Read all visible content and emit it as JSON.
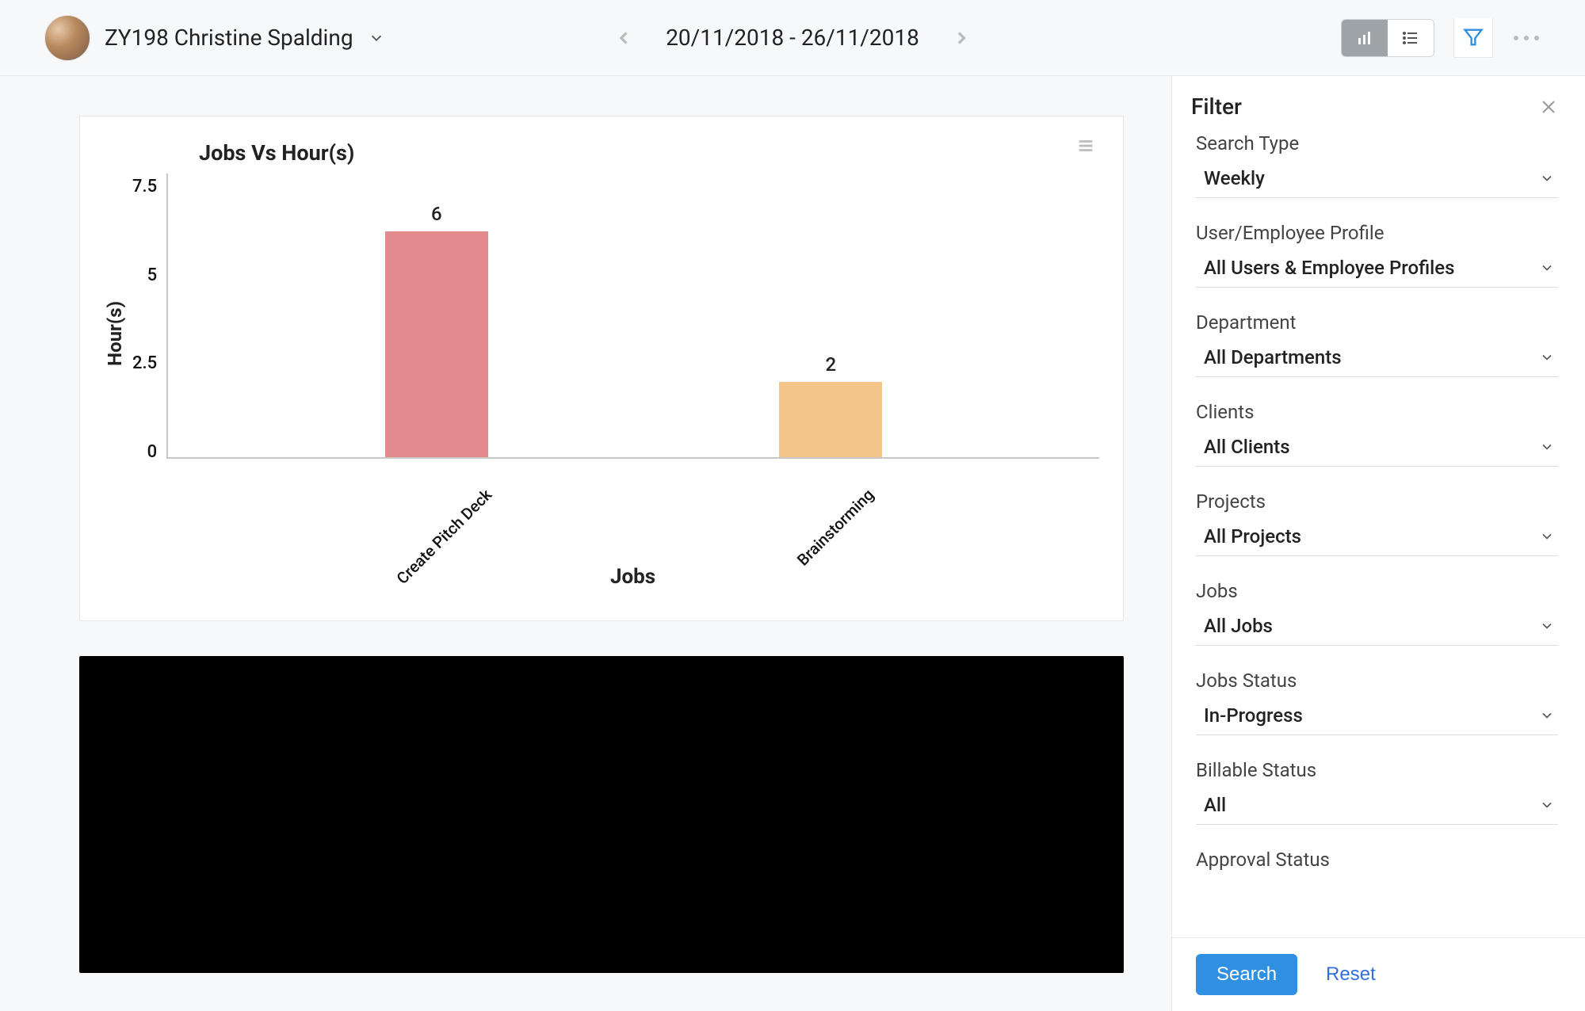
{
  "header": {
    "user_name": "ZY198 Christine Spalding",
    "date_range": "20/11/2018 - 26/11/2018"
  },
  "chart_data": {
    "type": "bar",
    "title": "Jobs Vs Hour(s)",
    "xlabel": "Jobs",
    "ylabel": "Hour(s)",
    "ylim": [
      0,
      7.5
    ],
    "y_ticks": [
      "7.5",
      "5",
      "2.5",
      "0"
    ],
    "categories": [
      "Create Pitch Deck",
      "Brainstorming"
    ],
    "values": [
      6,
      2
    ],
    "colors": [
      "#e48b8d",
      "#f3c58a"
    ]
  },
  "filter": {
    "title": "Filter",
    "groups": [
      {
        "label": "Search Type",
        "value": "Weekly"
      },
      {
        "label": "User/Employee Profile",
        "value": "All Users & Employee Profiles"
      },
      {
        "label": "Department",
        "value": "All Departments"
      },
      {
        "label": "Clients",
        "value": "All Clients"
      },
      {
        "label": "Projects",
        "value": "All Projects"
      },
      {
        "label": "Jobs",
        "value": "All Jobs"
      },
      {
        "label": "Jobs Status",
        "value": "In-Progress"
      },
      {
        "label": "Billable Status",
        "value": "All"
      },
      {
        "label": "Approval Status",
        "value": ""
      }
    ],
    "search_label": "Search",
    "reset_label": "Reset"
  }
}
